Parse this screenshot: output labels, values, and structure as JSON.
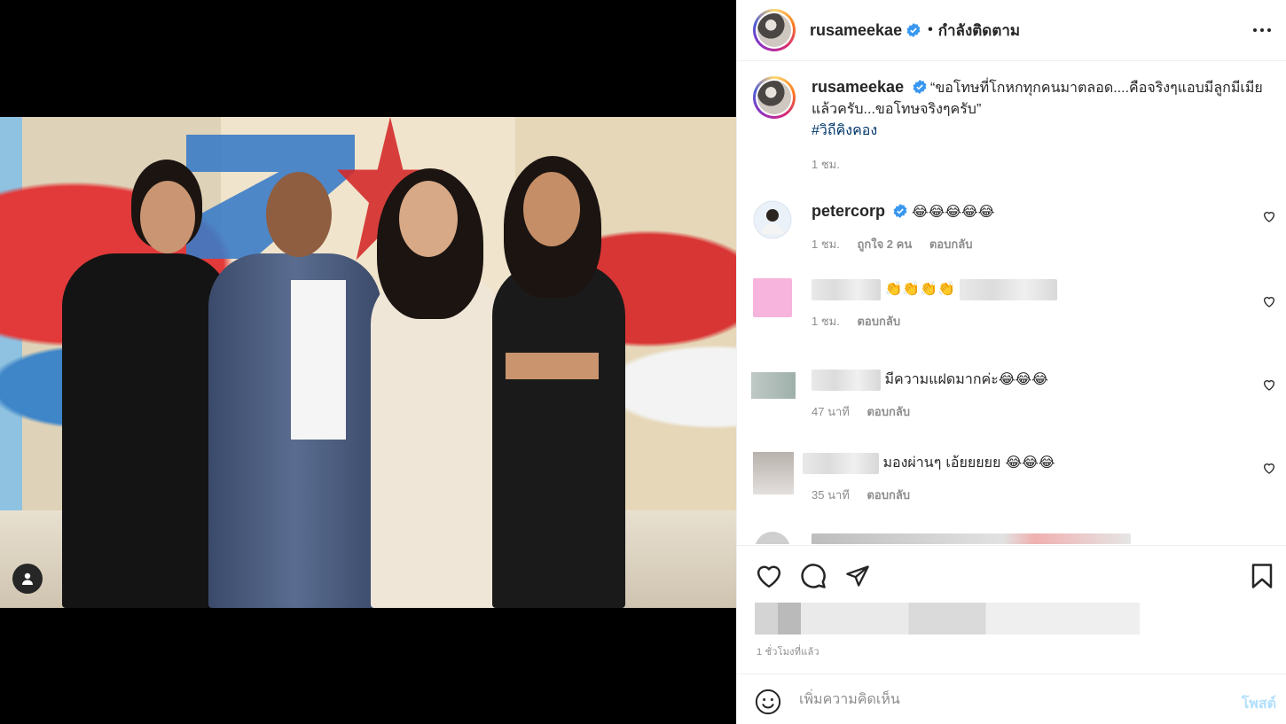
{
  "header": {
    "username": "rusameekae",
    "separator": "•",
    "follow_status": "กำลังติดตาม"
  },
  "caption": {
    "username": "rusameekae",
    "text": "“ขอโทษที่โกหกทุกคนมาตลอด....คือจริงๆแอบมีลูกมีเมียแล้วครับ...ขอโทษจริงๆครับ”",
    "hashtag": "#วิถีคิงคอง",
    "time": "1 ชม."
  },
  "comments": [
    {
      "username": "petercorp",
      "verified": true,
      "text": "😂😂😂😂😂",
      "time": "1 ชม.",
      "likes": "ถูกใจ 2 คน",
      "reply": "ตอบกลับ"
    },
    {
      "username": "",
      "text": "👏👏👏👏",
      "time": "1 ชม.",
      "reply": "ตอบกลับ"
    },
    {
      "username": "",
      "text": "มีความแฝดมากค่ะ😂😂😂",
      "time": "47 นาที",
      "reply": "ตอบกลับ"
    },
    {
      "username": "",
      "text": "มองผ่านๆ เอ้ยยยยย 😂😂😂",
      "time": "35 นาที",
      "reply": "ตอบกลับ"
    }
  ],
  "post": {
    "time_ago": "1 ชั่วโมงที่แล้ว"
  },
  "comment_box": {
    "placeholder": "เพิ่มความคิดเห็น",
    "post_label": "โพสต์"
  },
  "colors": {
    "verified": "#3897f0",
    "hashtag": "#00376b",
    "post_button_disabled": "#b2dffc",
    "muted_text": "#8e8e8e"
  },
  "icons": [
    "user-tag-icon",
    "verified-icon",
    "more-options-icon",
    "heart-icon",
    "comment-icon",
    "share-icon",
    "save-icon",
    "emoji-icon"
  ]
}
